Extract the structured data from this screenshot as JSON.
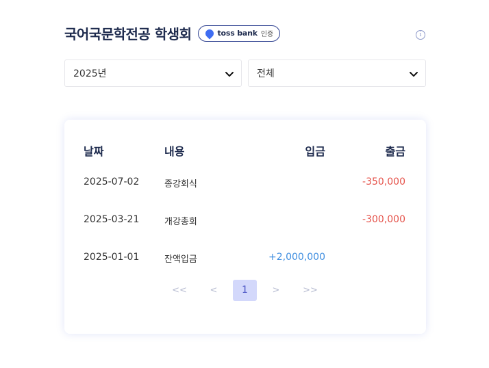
{
  "header": {
    "title": "국어국문학전공 학생회",
    "badge_brand": "toss bank",
    "badge_verified": "인증"
  },
  "filters": {
    "year": "2025년",
    "category": "전체"
  },
  "table": {
    "columns": [
      "날짜",
      "내용",
      "입금",
      "출금"
    ],
    "rows": [
      {
        "date": "2025-07-02",
        "desc": "종강회식",
        "deposit": "",
        "withdrawal": "-350,000"
      },
      {
        "date": "2025-03-21",
        "desc": "개강총회",
        "deposit": "",
        "withdrawal": "-300,000"
      },
      {
        "date": "2025-01-01",
        "desc": "잔액입금",
        "deposit": "+2,000,000",
        "withdrawal": ""
      }
    ]
  },
  "pagination": {
    "first": "<<",
    "prev": "<",
    "current": "1",
    "next": ">",
    "last": ">>"
  },
  "icons": {
    "info": "info-icon",
    "chevron": "chevron-down-icon",
    "brand": "tossbank-logo-icon"
  },
  "colors": {
    "title": "#1d2a4d",
    "deposit": "#3f8ee0",
    "withdrawal": "#e5524a",
    "page_active_bg": "#d3d8fb"
  }
}
